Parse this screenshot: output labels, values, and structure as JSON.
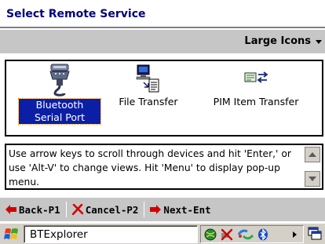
{
  "window": {
    "title": "Select Remote Service"
  },
  "view_selector": {
    "label": "Large Icons",
    "icon": "chevron-down-icon"
  },
  "services": [
    {
      "label": "Bluetooth Serial Port",
      "icon": "serial-port-connector-icon",
      "selected": true
    },
    {
      "label": "File Transfer",
      "icon": "file-transfer-icon",
      "selected": false
    },
    {
      "label": "PIM Item Transfer",
      "icon": "pim-transfer-icon",
      "selected": false
    }
  ],
  "help": {
    "text": "Use arrow keys to scroll through devices and hit 'Enter,' or use 'Alt-V' to change views. Hit 'Menu' to display pop-up menu."
  },
  "commands": {
    "back": "Back-P1",
    "cancel": "Cancel-P2",
    "next": "Next-Ent"
  },
  "taskbar": {
    "app_name": "BTExplorer"
  },
  "colors": {
    "title_text": "#000080",
    "selection_bg": "#0a1fa6",
    "bar_bg": "#c6c6c6",
    "arrow_red": "#d40000"
  }
}
